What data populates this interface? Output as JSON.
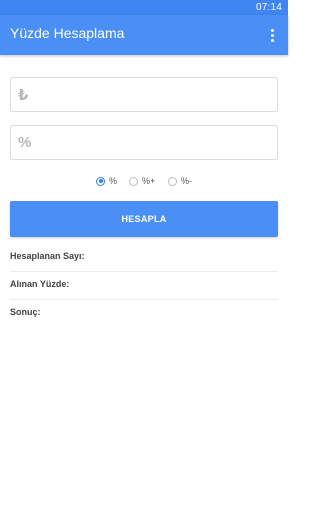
{
  "status_bar": {
    "time": "07:14"
  },
  "app_bar": {
    "title": "Yüzde Hesaplama",
    "menu_icon": "more-vert-icon"
  },
  "inputs": [
    {
      "prefix": "₺",
      "value": "",
      "placeholder": ""
    },
    {
      "prefix": "%",
      "value": "",
      "placeholder": ""
    }
  ],
  "radio_options": [
    {
      "label": "%",
      "checked": true
    },
    {
      "label": "%+",
      "checked": false
    },
    {
      "label": "%-",
      "checked": false
    }
  ],
  "calculate_button": {
    "label": "HESAPLA"
  },
  "results": [
    {
      "label": "Hesaplanan Sayı:",
      "value": ""
    },
    {
      "label": "Alınan Yüzde:",
      "value": ""
    },
    {
      "label": "Sonuç:",
      "value": ""
    }
  ],
  "colors": {
    "primary": "#4a8ff6",
    "status_bar": "#3f86f3",
    "radio_accent": "#2f80ed"
  }
}
